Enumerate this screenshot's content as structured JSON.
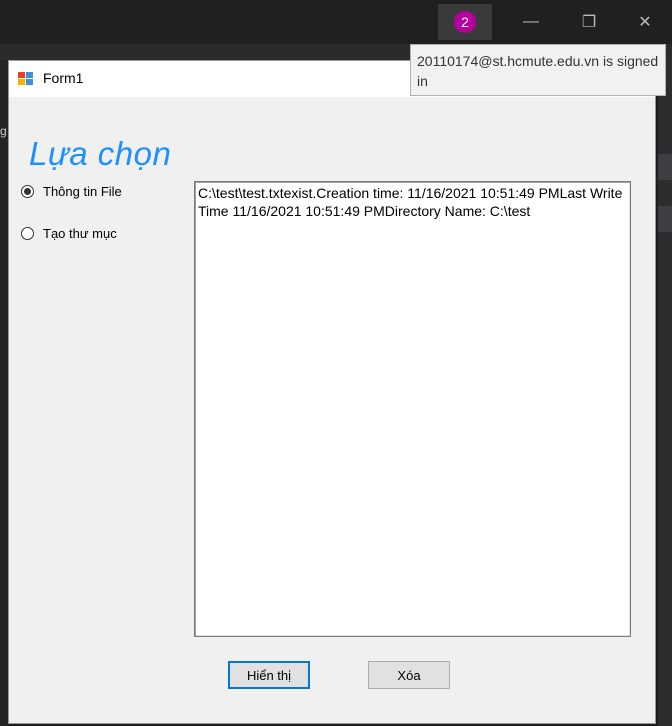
{
  "taskbar": {
    "account_badge": "2",
    "minimize_icon": "minimize-icon",
    "restore_icon": "restore-icon",
    "close_icon": "close-icon"
  },
  "tooltip": {
    "text": "20110174@st.hcmute.edu.vn is signed in"
  },
  "ide": {
    "left_fragment": "g"
  },
  "form": {
    "title": "Form1",
    "heading": "Lựa chọn",
    "radios": [
      {
        "label": "Thông tin File",
        "checked": true
      },
      {
        "label": "Tạo thư mục",
        "checked": false
      }
    ],
    "output_text": "C:\\test\\test.txtexist.Creation time: 11/16/2021 10:51:49 PMLast Write Time 11/16/2021 10:51:49 PMDirectory Name: C:\\test",
    "buttons": {
      "show_label": "Hiển thị",
      "clear_label": "Xóa"
    }
  },
  "colors": {
    "heading": "#1e8fff",
    "badge": "#b4009e",
    "default_button_border": "#0078d7"
  }
}
